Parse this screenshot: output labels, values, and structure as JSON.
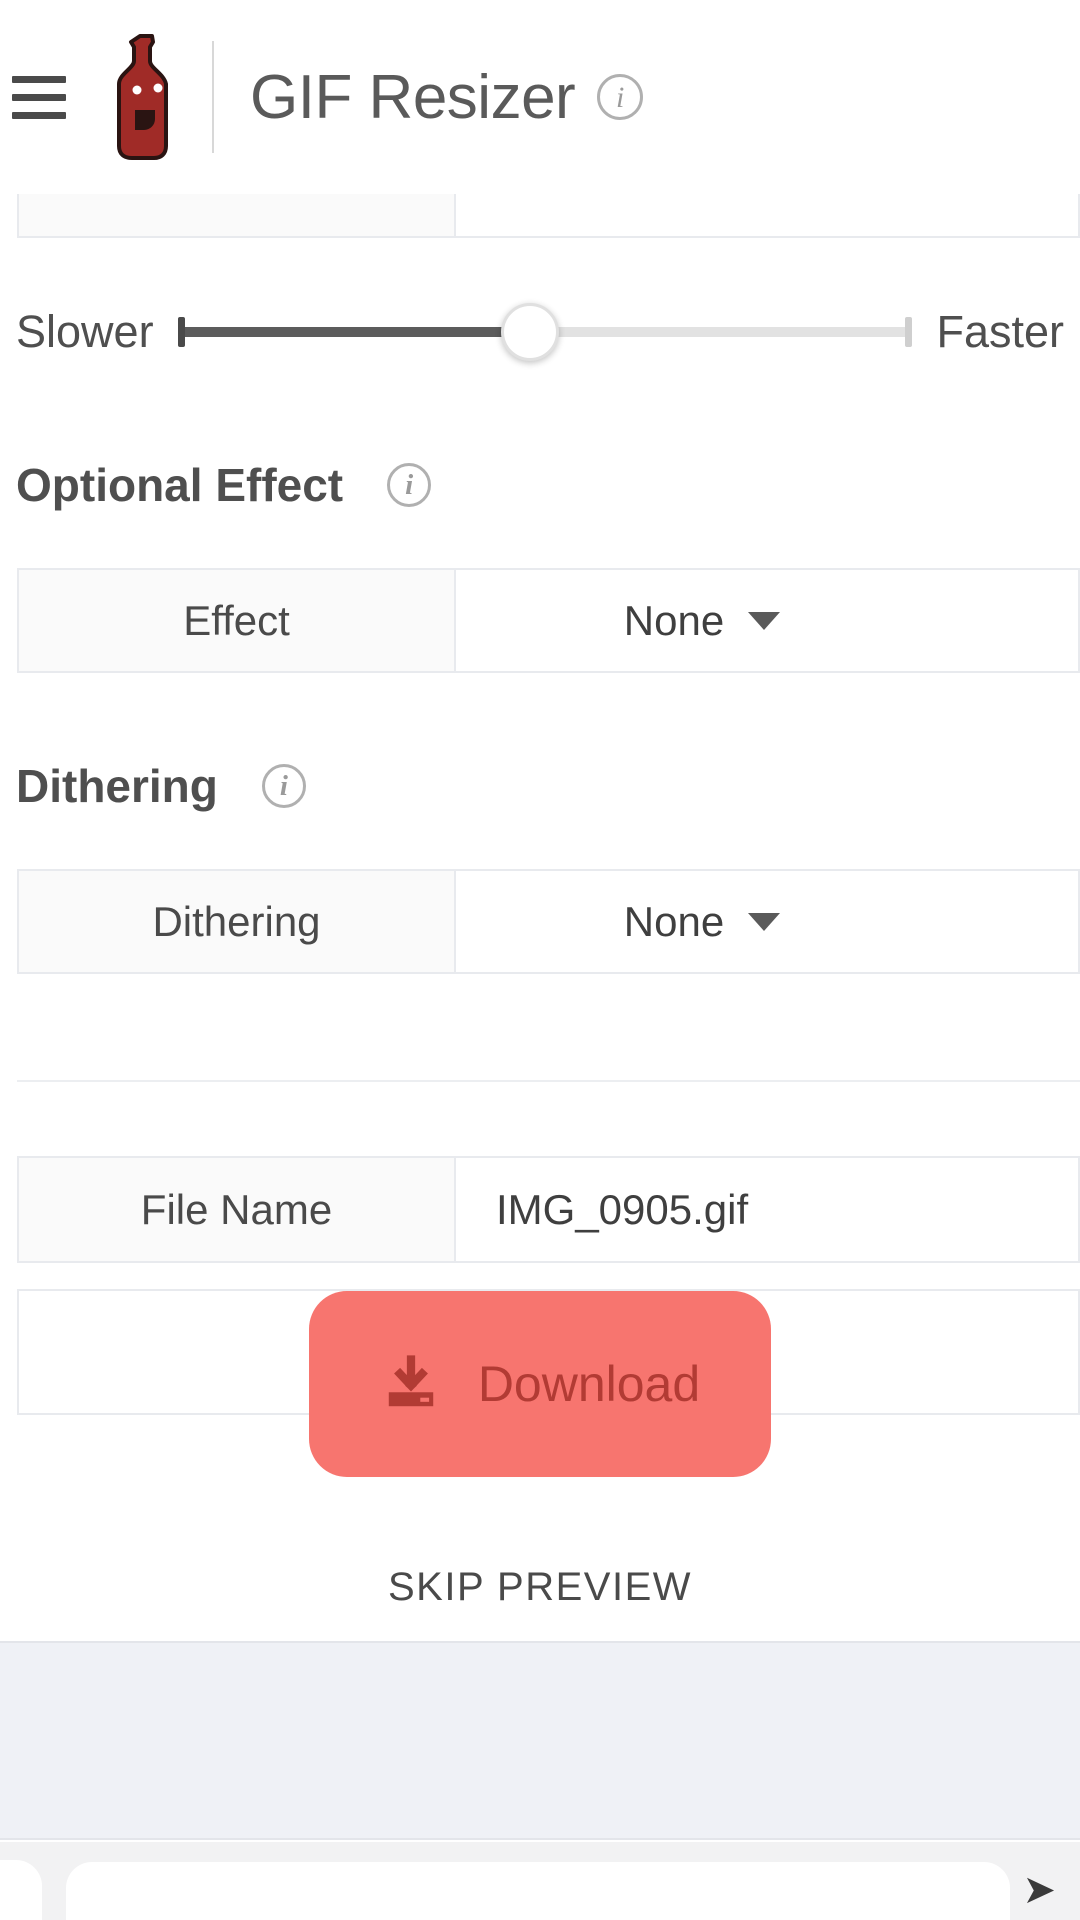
{
  "header": {
    "menu_icon": "hamburger-menu-icon",
    "logo_icon": "bottle-logo-icon",
    "title": "GIF Resizer",
    "info_icon": "info-icon"
  },
  "speed_slider": {
    "min_label": "Slower",
    "max_label": "Faster",
    "value_percent": 48,
    "fill_color": "#5c5c5c",
    "track_color": "#e2e2e2"
  },
  "optional_effect": {
    "heading": "Optional Effect",
    "info_icon": "info-icon",
    "row": {
      "label": "Effect",
      "value": "None",
      "caret_icon": "chevron-down-icon"
    }
  },
  "dithering": {
    "heading": "Dithering",
    "info_icon": "info-icon",
    "row": {
      "label": "Dithering",
      "value": "None",
      "caret_icon": "chevron-down-icon"
    }
  },
  "file_name": {
    "label": "File Name",
    "value": "IMG_0905.gif"
  },
  "download": {
    "button_label": "Download",
    "button_icon": "download-icon",
    "button_color": "#f7756f",
    "button_text_color": "#b23b34",
    "skip_preview_label": "SKIP PREVIEW"
  },
  "bottom": {
    "chrome_chevron_icon": "chevron-right-icon"
  }
}
